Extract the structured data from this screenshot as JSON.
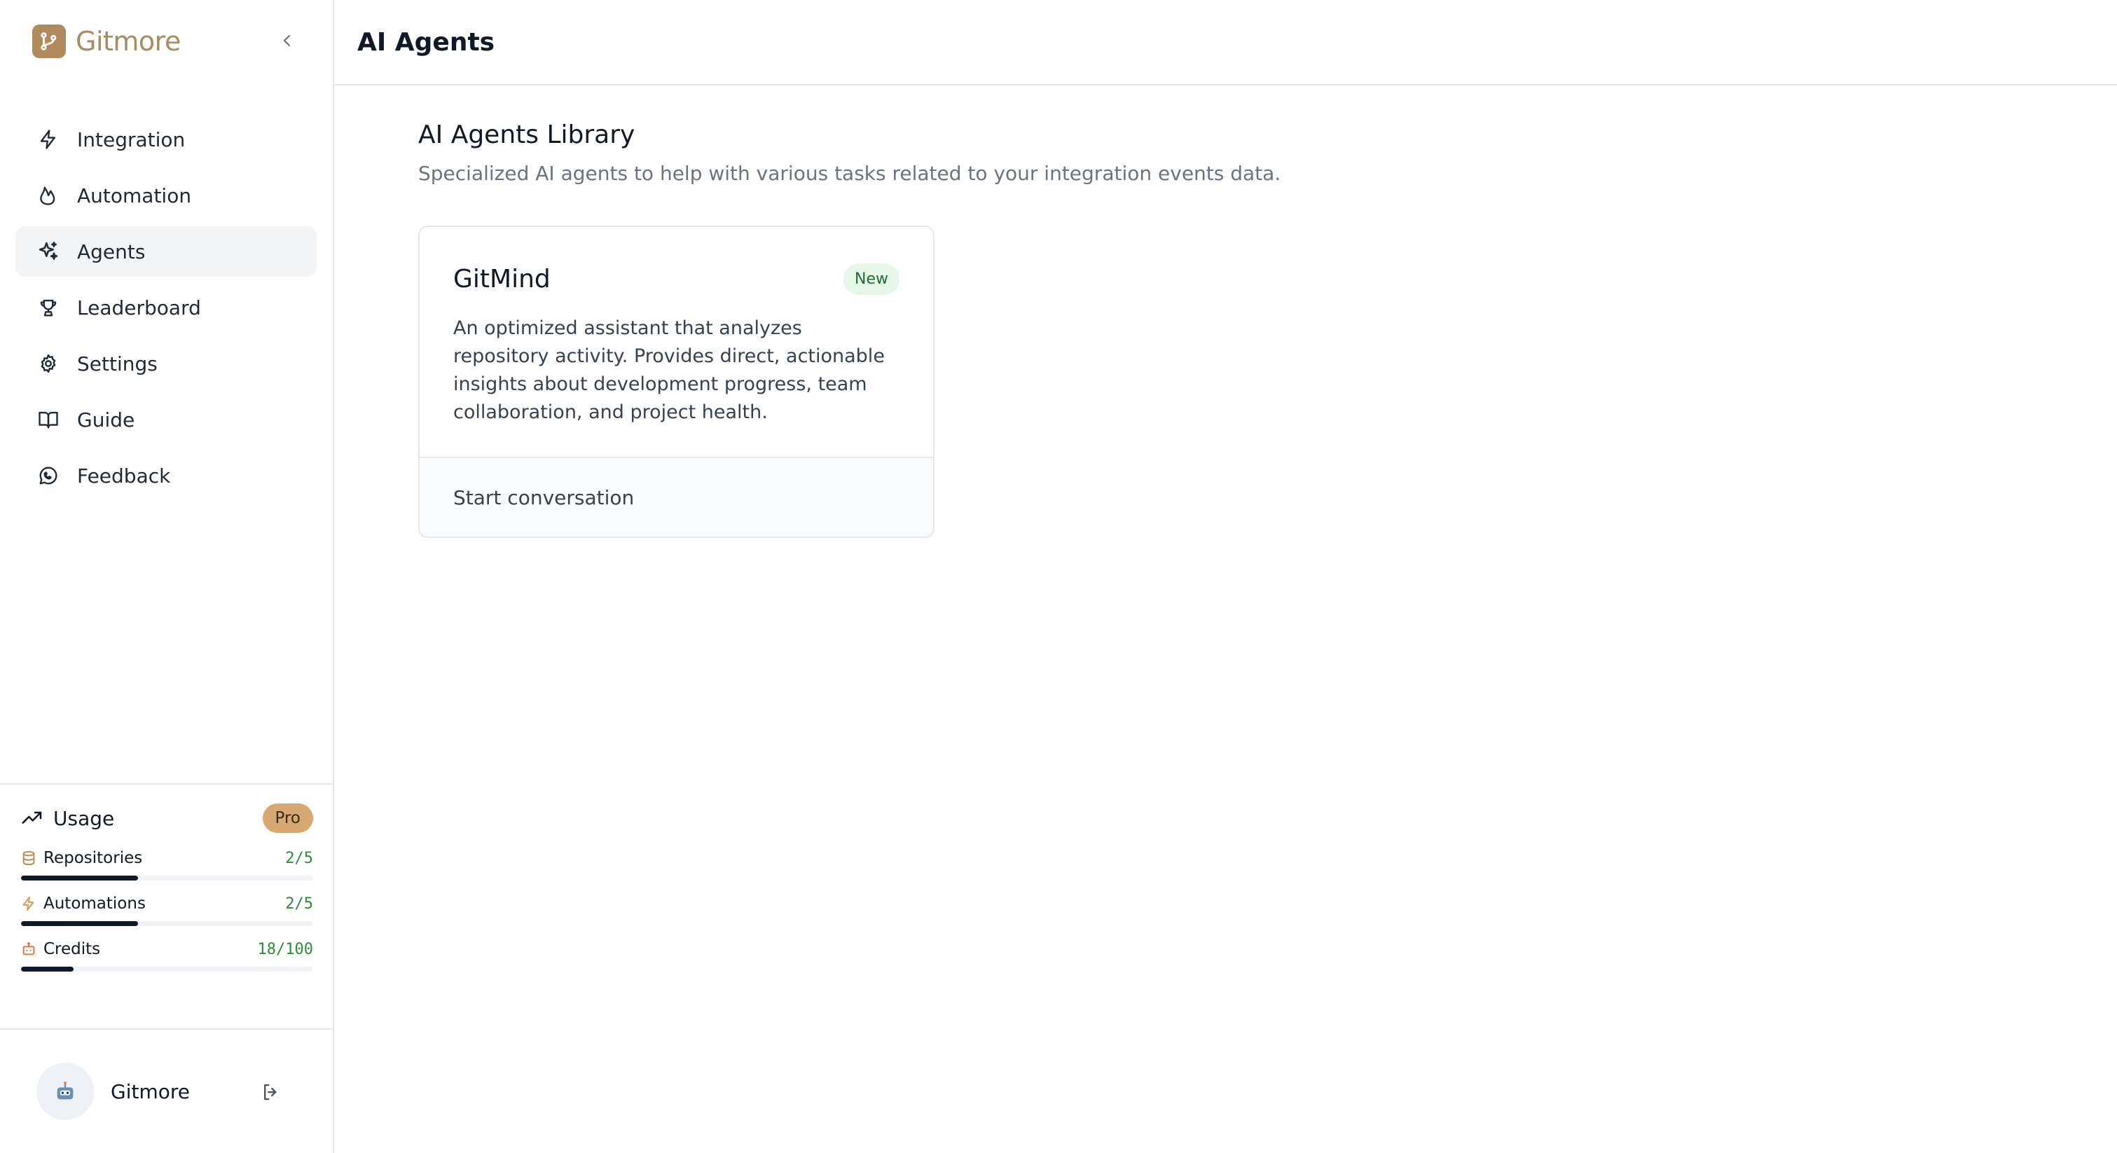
{
  "brand": {
    "name": "Gitmore"
  },
  "sidebar": {
    "items": [
      {
        "label": "Integration",
        "icon": "lightning-icon",
        "active": false
      },
      {
        "label": "Automation",
        "icon": "flame-icon",
        "active": false
      },
      {
        "label": "Agents",
        "icon": "sparkles-icon",
        "active": true
      },
      {
        "label": "Leaderboard",
        "icon": "trophy-icon",
        "active": false
      },
      {
        "label": "Settings",
        "icon": "gear-icon",
        "active": false
      },
      {
        "label": "Guide",
        "icon": "book-icon",
        "active": false
      },
      {
        "label": "Feedback",
        "icon": "chat-icon",
        "active": false
      }
    ]
  },
  "usage": {
    "title": "Usage",
    "plan": "Pro",
    "rows": [
      {
        "label": "Repositories",
        "count": "2/5",
        "fraction": 0.4,
        "icon": "database-icon",
        "icon_color": "#c08c4a"
      },
      {
        "label": "Automations",
        "count": "2/5",
        "fraction": 0.4,
        "icon": "lightning-icon",
        "icon_color": "#d99b57"
      },
      {
        "label": "Credits",
        "count": "18/100",
        "fraction": 0.18,
        "icon": "bot-icon",
        "icon_color": "#e07a3e"
      }
    ]
  },
  "profile": {
    "name": "Gitmore"
  },
  "header": {
    "title": "AI Agents"
  },
  "library": {
    "title": "AI Agents Library",
    "subtitle": "Specialized AI agents to help with various tasks related to your integration events data."
  },
  "agent_card": {
    "name": "GitMind",
    "badge": "New",
    "description": "An optimized assistant that analyzes repository activity. Provides direct, actionable insights about development progress, team collaboration, and project health.",
    "action": "Start conversation"
  },
  "colors": {
    "brand": "#a88c5f",
    "pro_badge": "#d8a873",
    "count_green": "#2f8a3c",
    "new_badge_bg": "#e6f6e8"
  }
}
